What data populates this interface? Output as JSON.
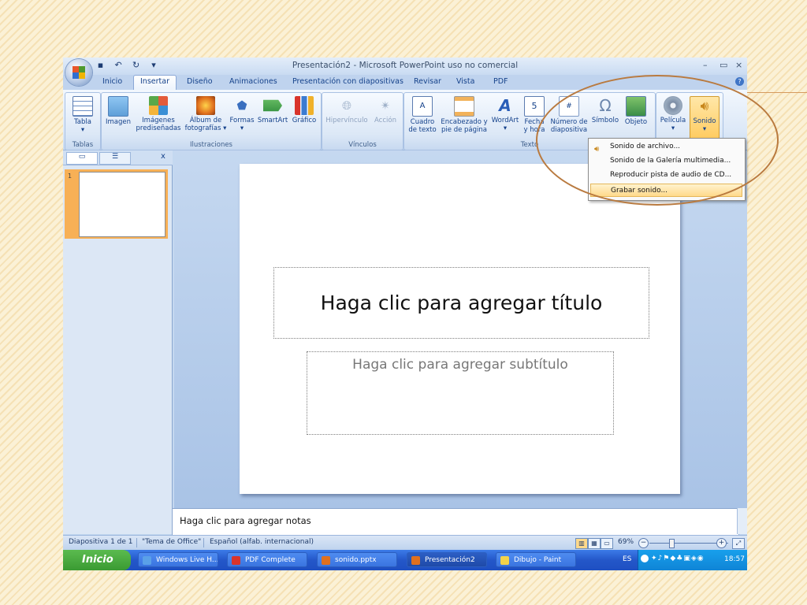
{
  "window": {
    "title": "Presentación2 - Microsoft PowerPoint uso no comercial",
    "minimize": "–",
    "maximize": "▭",
    "close": "×",
    "help": "?"
  },
  "quick_access": [
    "save-icon",
    "undo-icon",
    "redo-icon",
    "customize-icon"
  ],
  "tabs": [
    "Inicio",
    "Insertar",
    "Diseño",
    "Animaciones",
    "Presentación con diapositivas",
    "Revisar",
    "Vista",
    "PDF"
  ],
  "ribbon": {
    "groups": {
      "tablas": "Tablas",
      "ilustraciones": "Ilustraciones",
      "vinculos": "Vínculos",
      "texto": "Texto"
    },
    "buttons": {
      "tabla": [
        "Tabla",
        "▾"
      ],
      "imagen": "Imagen",
      "imagenes": [
        "Imágenes",
        "prediseñadas"
      ],
      "album": [
        "Álbum de",
        "fotografías ▾"
      ],
      "formas": [
        "Formas",
        "▾"
      ],
      "smartart": "SmartArt",
      "grafico": "Gráfico",
      "hipervinculo": "Hipervínculo",
      "accion": "Acción",
      "cuadro": [
        "Cuadro",
        "de texto"
      ],
      "encabezado": [
        "Encabezado y",
        "pie de página"
      ],
      "wordart": [
        "WordArt",
        "▾"
      ],
      "fecha": [
        "Fecha",
        "y hora"
      ],
      "numero": [
        "Número de",
        "diapositiva"
      ],
      "simbolo": "Símbolo",
      "objeto": "Objeto",
      "pelicula": [
        "Película",
        "▾"
      ],
      "sonido": [
        "Sonido",
        "▾"
      ]
    }
  },
  "panel": {
    "close": "x",
    "slide_number": "1"
  },
  "slide": {
    "title_placeholder": "Haga clic para agregar título",
    "subtitle_placeholder": "Haga clic para agregar subtítulo"
  },
  "notes_placeholder": "Haga clic para agregar notas",
  "status": {
    "slide_info": "Diapositiva 1 de 1",
    "theme": "\"Tema de Office\"",
    "language": "Español (alfab. internacional)",
    "zoom": "69%",
    "zoom_minus": "−",
    "zoom_plus": "+"
  },
  "taskbar": {
    "start": "Inicio",
    "tasks": [
      "Windows Live H...",
      "PDF Complete",
      "sonido.pptx",
      "Presentación2",
      "Dibujo - Paint"
    ],
    "language": "ES",
    "clock": "18:57"
  },
  "sound_menu": {
    "items": [
      "Sonido de archivo...",
      "Sonido de la Galería multimedia...",
      "Reproducir pista de audio de CD...",
      "Grabar sonido..."
    ],
    "highlighted_index": 3
  },
  "colors": {
    "highlight_ellipse": "#b97a3f",
    "office_orange": "#f7b056",
    "taskbar_blue": "#2457c9",
    "start_green": "#3a9a32"
  }
}
